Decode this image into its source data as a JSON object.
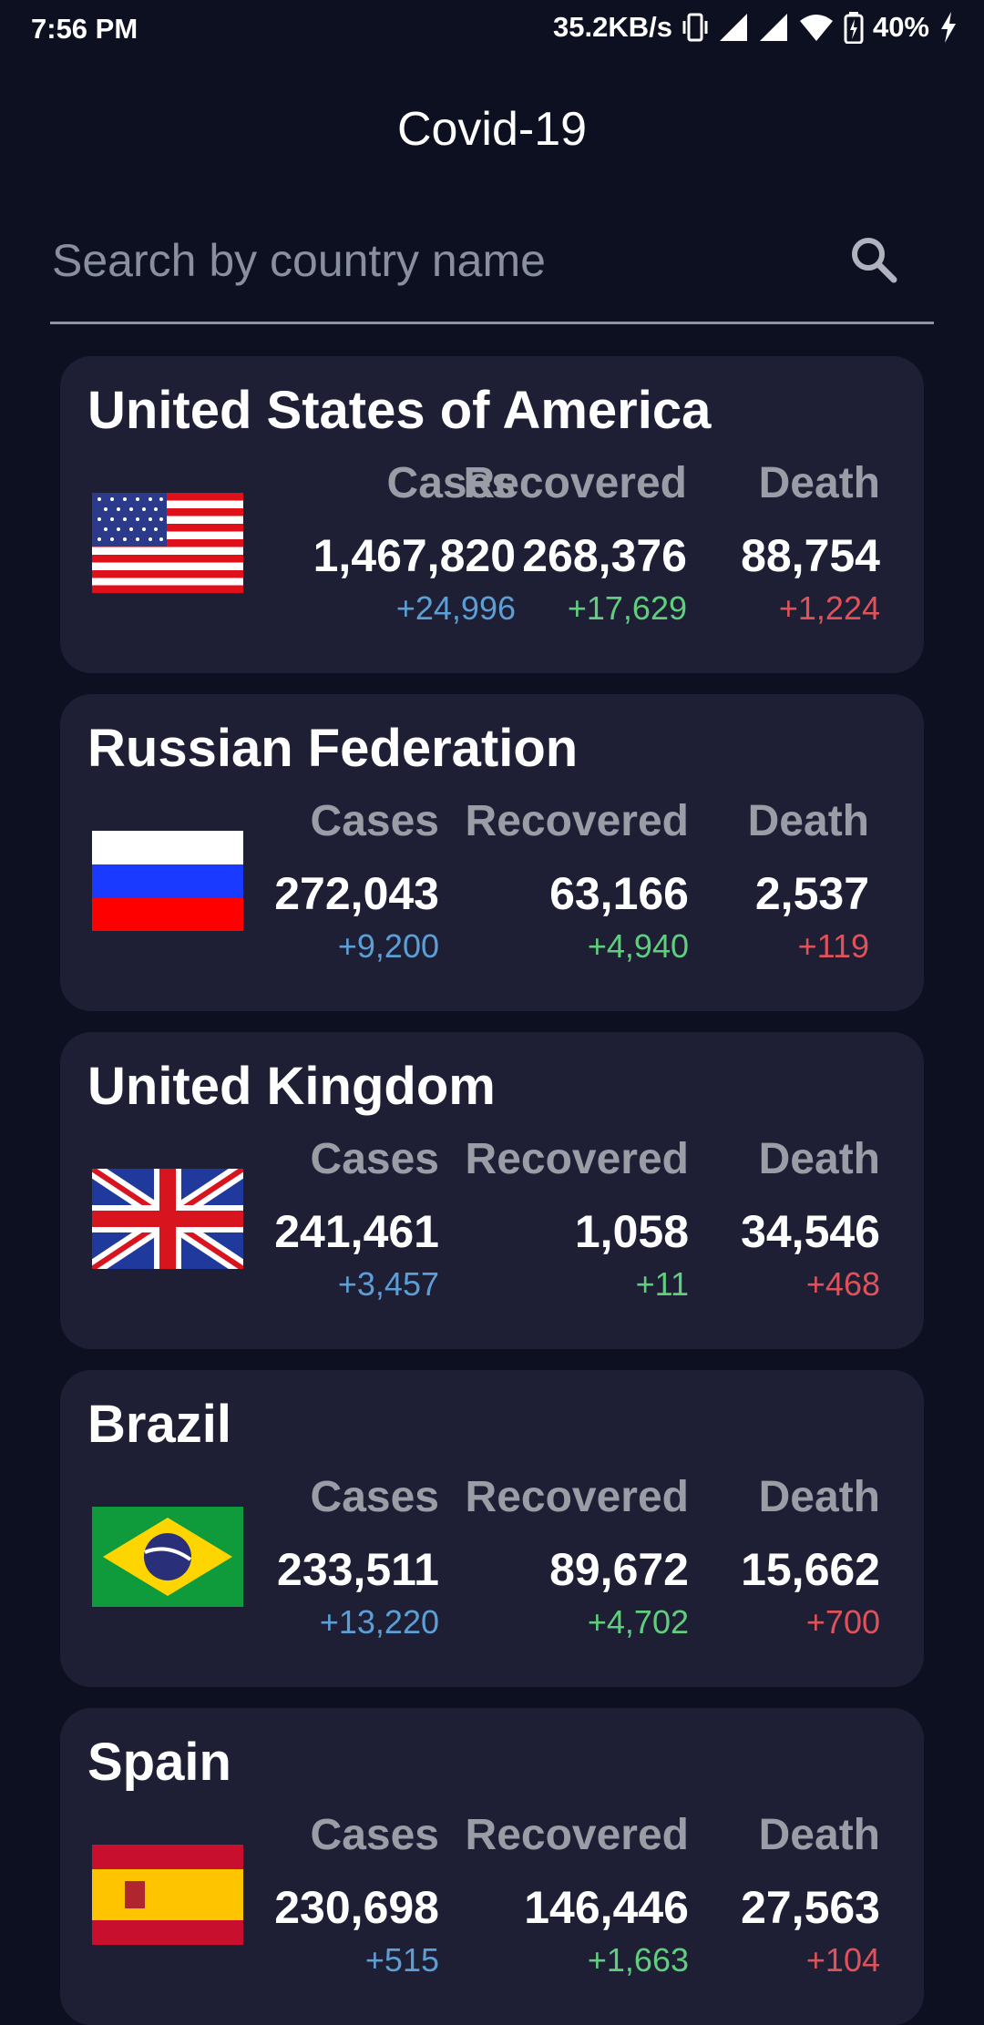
{
  "status_bar": {
    "time": "7:56 PM",
    "network_speed": "35.2KB/s",
    "battery": "40%"
  },
  "app": {
    "title": "Covid-19"
  },
  "search": {
    "placeholder": "Search by country name"
  },
  "columns": {
    "cases": "Cases",
    "recovered": "Recovered",
    "death": "Death"
  },
  "countries": [
    {
      "name": "United States of America",
      "flag": "us-flag",
      "cases": "1,467,820",
      "cases_delta": "+24,996",
      "recovered": "268,376",
      "recovered_delta": "+17,629",
      "death": "88,754",
      "death_delta": "+1,224"
    },
    {
      "name": "Russian Federation",
      "flag": "russia-flag",
      "cases": "272,043",
      "cases_delta": "+9,200",
      "recovered": "63,166",
      "recovered_delta": "+4,940",
      "death": "2,537",
      "death_delta": "+119"
    },
    {
      "name": "United Kingdom",
      "flag": "uk-flag",
      "cases": "241,461",
      "cases_delta": "+3,457",
      "recovered": "1,058",
      "recovered_delta": "+11",
      "death": "34,546",
      "death_delta": "+468"
    },
    {
      "name": "Brazil",
      "flag": "brazil-flag",
      "cases": "233,511",
      "cases_delta": "+13,220",
      "recovered": "89,672",
      "recovered_delta": "+4,702",
      "death": "15,662",
      "death_delta": "+700"
    },
    {
      "name": "Spain",
      "flag": "spain-flag",
      "cases": "230,698",
      "cases_delta": "+515",
      "recovered": "146,446",
      "recovered_delta": "+1,663",
      "death": "27,563",
      "death_delta": "+104"
    }
  ],
  "colors": {
    "background": "#0c1020",
    "card": "#1e1f35",
    "cases_delta": "#5b9fd6",
    "recovered_delta": "#5fcf7e",
    "death_delta": "#e0525a"
  }
}
